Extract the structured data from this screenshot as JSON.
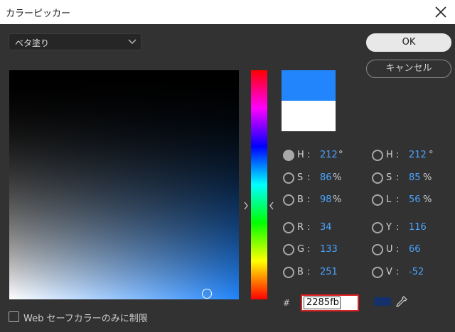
{
  "window": {
    "title": "カラーピッカー"
  },
  "mode_select": {
    "value": "ベタ塗り"
  },
  "buttons": {
    "ok": "OK",
    "cancel": "キャンセル"
  },
  "colors": {
    "new": "#2285fb",
    "old": "#ffffff",
    "current_swatch": "#14316b",
    "hex_border": "#e02020",
    "value_text": "#4aa3ff"
  },
  "hsb": [
    {
      "label": "H",
      "value": "212",
      "unit": "°",
      "selected": true
    },
    {
      "label": "S",
      "value": "86",
      "unit": "%",
      "selected": false
    },
    {
      "label": "B",
      "value": "98",
      "unit": "%",
      "selected": false
    }
  ],
  "rgb": [
    {
      "label": "R",
      "value": "34",
      "selected": false
    },
    {
      "label": "G",
      "value": "133",
      "selected": false
    },
    {
      "label": "B",
      "value": "251",
      "selected": false
    }
  ],
  "hsl": [
    {
      "label": "H",
      "value": "212",
      "unit": "°",
      "selected": false
    },
    {
      "label": "S",
      "value": "85",
      "unit": "%",
      "selected": false
    },
    {
      "label": "L",
      "value": "56",
      "unit": "%",
      "selected": false
    }
  ],
  "yuv": [
    {
      "label": "Y",
      "value": "116",
      "selected": false
    },
    {
      "label": "U",
      "value": "66",
      "selected": false
    },
    {
      "label": "V",
      "value": "-52",
      "selected": false
    }
  ],
  "separator": ":",
  "hex": {
    "prefix": "#",
    "value": "2285fb"
  },
  "websafe": {
    "label": "Web セーフカラーのみに制限",
    "checked": false
  }
}
